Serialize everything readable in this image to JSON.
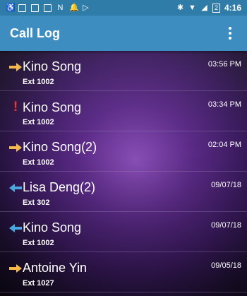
{
  "status_bar": {
    "time": "4:16",
    "battery_level": "2"
  },
  "app_bar": {
    "title": "Call Log"
  },
  "calls": [
    {
      "direction": "outgoing",
      "name": "Kino Song",
      "ext": "Ext 1002",
      "time": "03:56 PM"
    },
    {
      "direction": "missed",
      "name": "Kino Song",
      "ext": "Ext 1002",
      "time": "03:34 PM"
    },
    {
      "direction": "outgoing",
      "name": "Kino Song(2)",
      "ext": "Ext  1002",
      "time": "02:04 PM"
    },
    {
      "direction": "incoming",
      "name": "Lisa Deng(2)",
      "ext": "Ext  302",
      "time": "09/07/18"
    },
    {
      "direction": "incoming",
      "name": "Kino Song",
      "ext": "Ext  1002",
      "time": "09/07/18"
    },
    {
      "direction": "outgoing",
      "name": "Antoine Yin",
      "ext": "Ext 1027",
      "time": "09/05/18"
    }
  ],
  "colors": {
    "status_bar": "#2f7ca9",
    "app_bar": "#3d8dc1",
    "outgoing_arrow": "#f5b84a",
    "incoming_arrow": "#4aa8e0",
    "missed": "#e53935"
  },
  "icons": {
    "outgoing": "arrow-right-icon",
    "incoming": "arrow-left-icon",
    "missed": "exclamation-icon",
    "menu": "more-vert-icon"
  }
}
